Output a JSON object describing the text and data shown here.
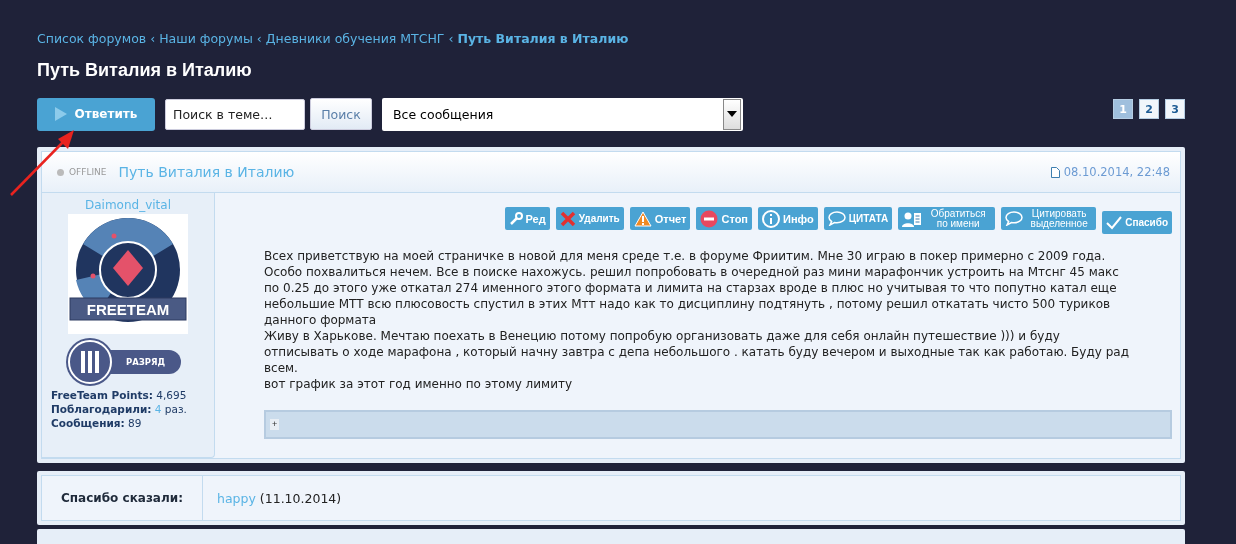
{
  "breadcrumbs": [
    {
      "label": "Список форумов",
      "current": false
    },
    {
      "label": "Наши форумы",
      "sep": "‹",
      "current": false
    },
    {
      "label": "Дневники обучения МТСНГ",
      "sep": "‹",
      "current": false
    },
    {
      "label": "Путь Виталия в Италию",
      "sep": "‹",
      "current": true
    }
  ],
  "title": "Путь Виталия в Италию",
  "toolbar": {
    "reply": "Ответить",
    "search": {
      "placeholder": "Поиск в теме…"
    },
    "search_button": "Поиск",
    "filter": "Все сообщения"
  },
  "pagination": [
    {
      "label": "1",
      "selected": true
    },
    {
      "label": "2",
      "selected": false
    },
    {
      "label": "3",
      "selected": false
    }
  ],
  "post": {
    "status": "OFFLINE",
    "online": false,
    "subject": "Путь Виталия в Италию",
    "date": "08.10.2014, 22:48",
    "author": {
      "name": "Daimond_vital",
      "avatar_text": "FREETEAM",
      "rank": "РАЗРЯД",
      "stats": [
        {
          "label": "FreeTeam Points:",
          "value": "4,695",
          "link": false
        },
        {
          "label": "Поблагодарили:",
          "value": "4",
          "link": true,
          "suffix": "раз."
        },
        {
          "label": "Сообщения:",
          "value": "89",
          "link": false
        }
      ]
    },
    "actions": [
      {
        "kind": "edit",
        "label": "Ред"
      },
      {
        "kind": "delete",
        "label": "Удалить"
      },
      {
        "kind": "report",
        "label": "Отчет"
      },
      {
        "kind": "stop",
        "label": "Стоп"
      },
      {
        "kind": "info",
        "label": "Инфо"
      },
      {
        "kind": "quote",
        "label": "ЦИТАТА"
      },
      {
        "kind": "mention",
        "label": "Обратиться по имени"
      },
      {
        "kind": "quote-selected",
        "label": "Цитировать выделенное"
      },
      {
        "kind": "thanks",
        "label": "Спасибо"
      }
    ],
    "paragraphs": [
      "Всех приветствую на моей страничке в новой для меня среде т.е. в форуме Фриитим. Мне 30 играю в покер примерно с 2009 года.",
      "Особо похвалиться нечем. Все в поиске нахожусь. решил попробовать в очередной раз мини марафончик устроить на Мтснг 45 макс по 0.25 до этого уже откатал 274 именного этого формата и лимита на старзах вроде в плюс но учитывая то что попутно катал еще небольшие МТТ всю плюсовость спустил в этих Мтт надо как то дисциплину подтянуть , потому решил откатать чисто 500 туриков данного формата",
      "Живу в Харькове. Мечтаю поехать в Венецию потому попробую организовать даже для себя онлайн путешествие ))) и буду отписывать о ходе марафона , который начну завтра с депа небольшого . катать буду вечером и выходные так как работаю. Буду рад всем.",
      "вот график за этот год именно по этому лимиту"
    ],
    "spoiler": {
      "toggle": "+",
      "expanded": false
    }
  },
  "thanks": {
    "label": "Спасибо сказали:",
    "users": [
      {
        "name": "happy",
        "date": "(11.10.2014)"
      }
    ]
  }
}
